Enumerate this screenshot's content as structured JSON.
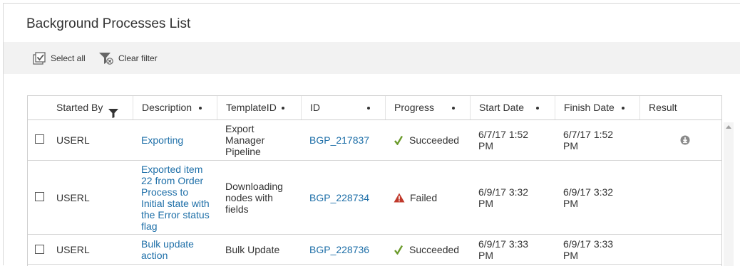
{
  "page": {
    "title": "Background Processes List"
  },
  "toolbar": {
    "select_all": "Select all",
    "clear_filter": "Clear filter"
  },
  "columns": [
    {
      "label": "Started By",
      "icon": "filter-icon"
    },
    {
      "label": "Description",
      "icon": "sort-dot"
    },
    {
      "label": "TemplateID",
      "icon": "sort-dot"
    },
    {
      "label": "ID",
      "icon": "sort-dot"
    },
    {
      "label": "Progress",
      "icon": "sort-dot"
    },
    {
      "label": "Start Date",
      "icon": "sort-dot"
    },
    {
      "label": "Finish Date",
      "icon": "sort-dot"
    },
    {
      "label": "Result",
      "icon": ""
    }
  ],
  "rows": [
    {
      "started_by": "USERL",
      "description": "Exporting",
      "template_id": "Export Manager Pipeline",
      "id": "BGP_217837",
      "progress": "Succeeded",
      "progress_icon": "checkmark-icon",
      "start_date": "6/7/17 1:52 PM",
      "finish_date": "6/7/17 1:52 PM",
      "result_icon": "download-icon"
    },
    {
      "started_by": "USERL",
      "description": "Exported item 22 from Order Process to Initial state with the Error status flag",
      "template_id": "Downloading nodes with fields",
      "id": "BGP_228734",
      "progress": "Failed",
      "progress_icon": "warning-icon",
      "start_date": "6/9/17 3:32 PM",
      "finish_date": "6/9/17 3:32 PM",
      "result_icon": ""
    },
    {
      "started_by": "USERL",
      "description": "Bulk update action",
      "template_id": "Bulk Update",
      "id": "BGP_228736",
      "progress": "Succeeded",
      "progress_icon": "checkmark-icon",
      "start_date": "6/9/17 3:33 PM",
      "finish_date": "6/9/17 3:33 PM",
      "result_icon": ""
    }
  ],
  "colors": {
    "link": "#1e6fa8",
    "success": "#6a9a2a",
    "failed": "#c0392b",
    "toolbar_bg": "#f2f2f2"
  }
}
